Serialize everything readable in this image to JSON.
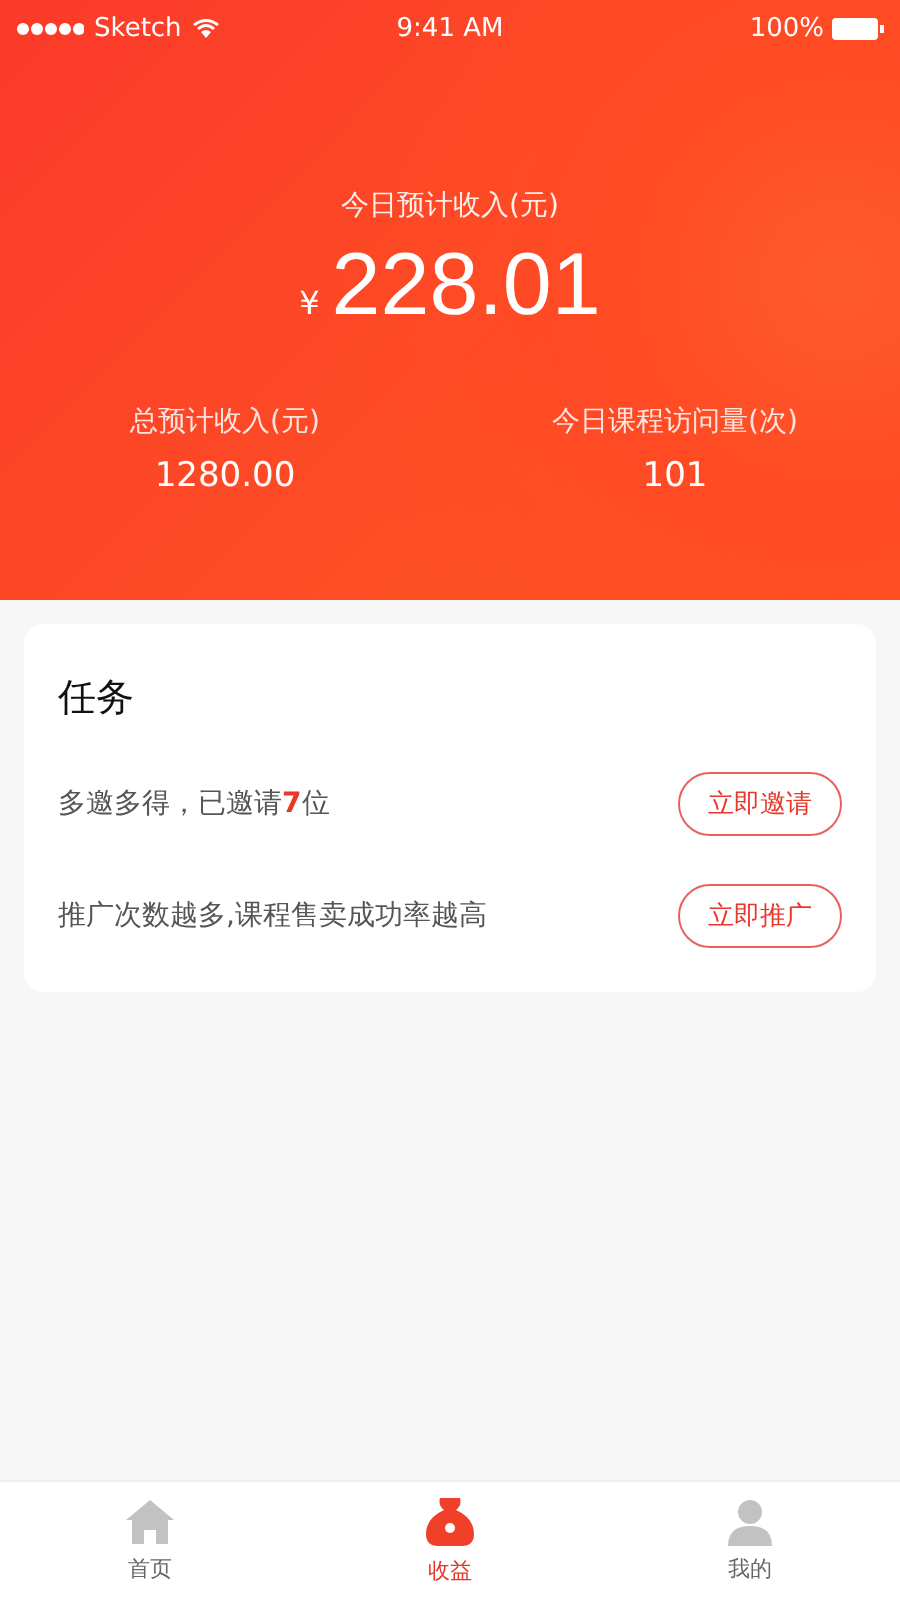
{
  "status_bar": {
    "carrier": "Sketch",
    "time": "9:41 AM",
    "battery": "100%"
  },
  "header": {
    "today_label": "今日预计收入(元)",
    "currency": "¥",
    "today_amount": "228.01",
    "stats": [
      {
        "label": "总预计收入(元)",
        "value": "1280.00"
      },
      {
        "label": "今日课程访问量(次)",
        "value": "101"
      }
    ]
  },
  "tasks": {
    "title": "任务",
    "items": [
      {
        "text": "多邀多得，已邀请**7**位",
        "button": "立即邀请"
      },
      {
        "text": "推广次数越多,课程售卖成功率越高",
        "button": "立即推广"
      }
    ]
  },
  "tab_bar": [
    {
      "kind": "home",
      "label": "首页",
      "selected": false
    },
    {
      "kind": "bag",
      "label": "收益",
      "selected": true
    },
    {
      "kind": "person",
      "label": "我的",
      "selected": false
    }
  ]
}
